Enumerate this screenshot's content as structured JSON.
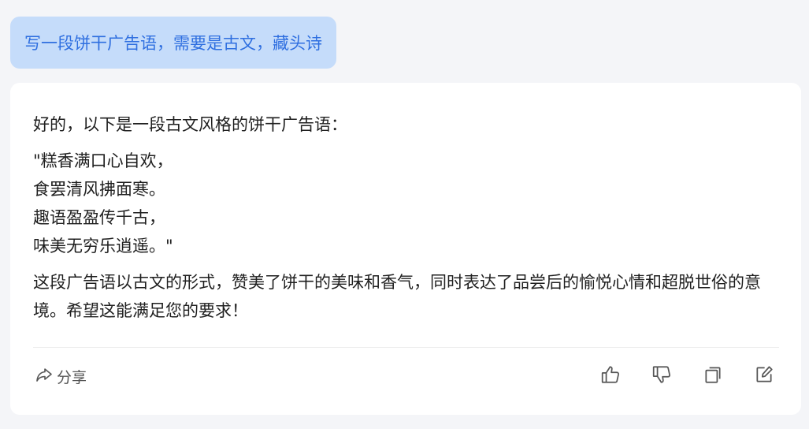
{
  "user_message": "写一段饼干广告语，需要是古文，藏头诗",
  "answer": {
    "intro": "好的，以下是一段古文风格的饼干广告语：",
    "poem_lines": [
      "\"糕香满口心自欢，",
      "食罢清风拂面寒。",
      "趣语盈盈传千古，",
      "味美无穷乐逍遥。\""
    ],
    "summary": "这段广告语以古文的形式，赞美了饼干的美味和香气，同时表达了品尝后的愉悦心情和超脱世俗的意境。希望这能满足您的要求！"
  },
  "actions": {
    "share_label": "分享",
    "icons": [
      "share-icon",
      "thumbs-up-icon",
      "thumbs-down-icon",
      "copy-icon",
      "edit-icon"
    ]
  },
  "colors": {
    "background": "#f4f5f8",
    "user_bubble_bg": "#c5dcfa",
    "user_bubble_text": "#2f6fe0",
    "card_bg": "#ffffff",
    "icon": "#555555"
  }
}
